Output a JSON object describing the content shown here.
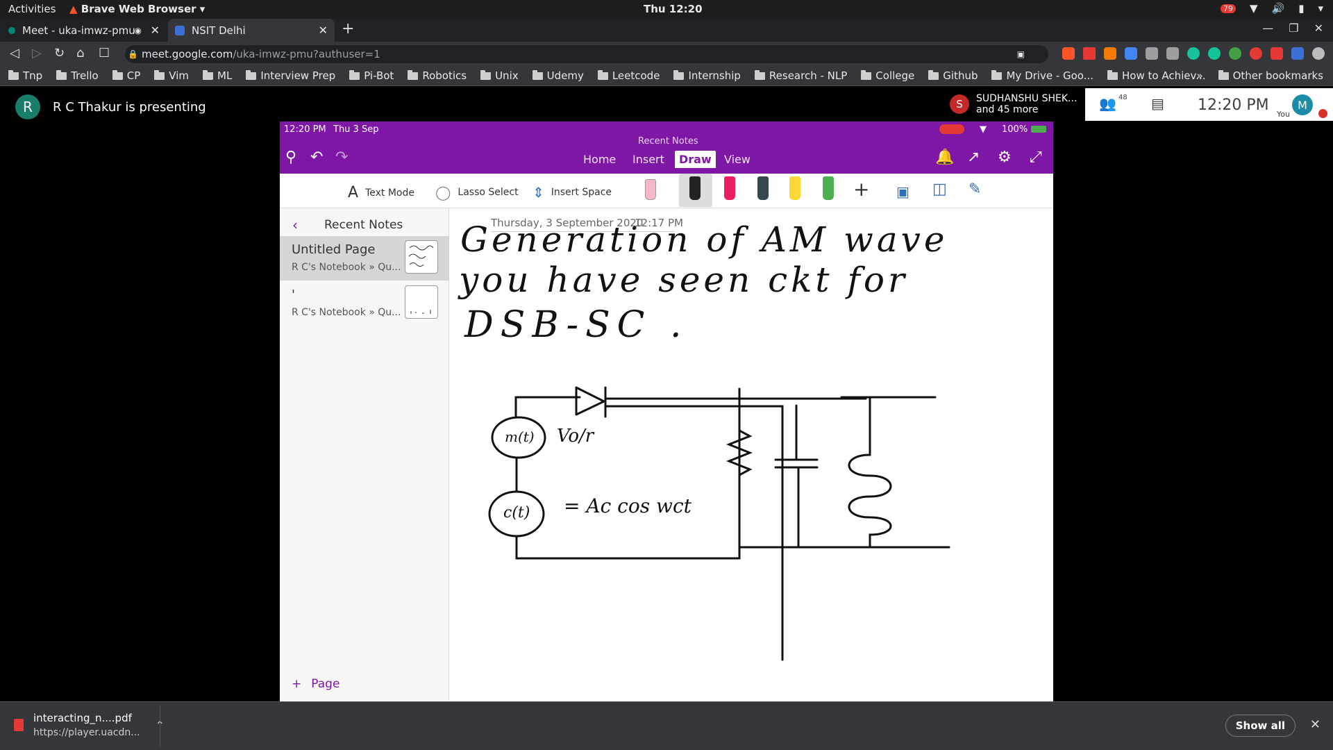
{
  "system_bar": {
    "activities": "Activities",
    "app_name": "Brave Web Browser",
    "clock": "Thu 12:20",
    "notification_count": "79"
  },
  "tabs": [
    {
      "title": "Meet - uka-imwz-pmu"
    },
    {
      "title": "NSIT Delhi"
    }
  ],
  "address_bar": {
    "host": "meet.google.com",
    "path": "/uka-imwz-pmu?authuser=1"
  },
  "bookmarks": [
    {
      "label": "Tnp"
    },
    {
      "label": "Trello"
    },
    {
      "label": "CP"
    },
    {
      "label": "Vim"
    },
    {
      "label": "ML"
    },
    {
      "label": "Interview Prep"
    },
    {
      "label": "Pi-Bot"
    },
    {
      "label": "Robotics"
    },
    {
      "label": "Unix"
    },
    {
      "label": "Udemy"
    },
    {
      "label": "Leetcode"
    },
    {
      "label": "Internship"
    },
    {
      "label": "Research - NLP"
    },
    {
      "label": "College"
    },
    {
      "label": "Github"
    },
    {
      "label": "My Drive - Goo..."
    },
    {
      "label": "How to Achiev..."
    }
  ],
  "bookmarks_overflow": "»",
  "other_bookmarks": "Other bookmarks",
  "meet": {
    "presenter_initial": "R",
    "presenter_text": "R C Thakur is presenting",
    "participant_initial": "S",
    "participant_name": "SUDHANSHU SHEK...",
    "participant_more": "and 45 more",
    "people_count": "48",
    "clock": "12:20 PM",
    "self_initial": "M",
    "self_label": "You"
  },
  "onenote": {
    "status_time": "12:20 PM",
    "status_date": "Thu 3 Sep",
    "battery": "100%",
    "title": "Recent Notes",
    "nav": [
      "Home",
      "Insert",
      "Draw",
      "View"
    ],
    "active_nav": "Draw",
    "ribbon": {
      "text_mode": "Text Mode",
      "lasso": "Lasso Select",
      "insert_space": "Insert Space"
    },
    "sidebar_header": "Recent Notes",
    "pages": [
      {
        "title": "Untitled Page",
        "subtitle": "R C's Notebook » Qu..."
      },
      {
        "title": "'",
        "subtitle": "R C's Notebook » Qu..."
      }
    ],
    "add_page": "Page",
    "note_date": "Thursday, 3 September 2020",
    "note_time": "12:17 PM",
    "handwriting": {
      "line1": "Generation of AM wave",
      "line2": "you have seen ckt for",
      "line3": "DSB-SC .",
      "label_m": "m(t)",
      "label_vo": "Vo/r",
      "label_c": "c(t)",
      "eq": "= Ac cos wct"
    }
  },
  "download": {
    "filename": "interacting_n....pdf",
    "source": "https://player.uacdn...",
    "show_all": "Show all"
  },
  "colors": {
    "onenote_purple": "#7e17a5",
    "meet_teal": "#1a7d6b",
    "chrome_dark": "#35363a"
  }
}
